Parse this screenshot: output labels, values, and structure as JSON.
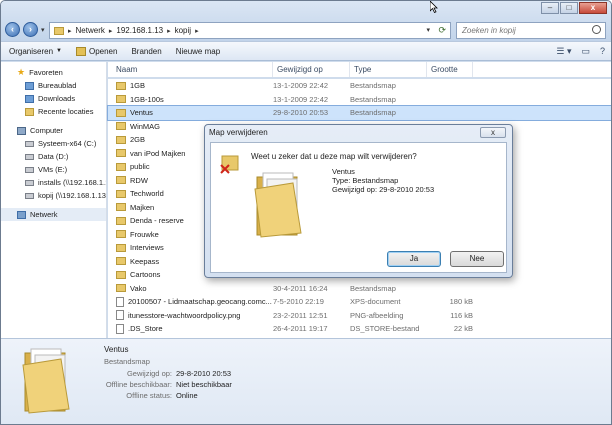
{
  "window": {
    "nav": {
      "back": "‹",
      "forward": "›"
    },
    "address": {
      "crumbs": [
        "Netwerk",
        "192.168.1.13",
        "kopij"
      ]
    },
    "search_placeholder": "Zoeken in kopij",
    "controls": {
      "minimize": "–",
      "maximize": "□",
      "close": "x"
    }
  },
  "toolbar": {
    "organize": "Organiseren",
    "open": "Openen",
    "burn": "Branden",
    "new_folder": "Nieuwe map"
  },
  "navpane": {
    "favorites": "Favoreten",
    "desktop": "Bureaublad",
    "downloads": "Downloads",
    "recent": "Recente locaties",
    "computer": "Computer",
    "drives": [
      "Systeem-x64 (C:)",
      "Data (D:)",
      "VMs (E:)",
      "installs (\\\\192.168.1.13",
      "kopij (\\\\192.168.1.13"
    ],
    "network": "Netwerk"
  },
  "columns": {
    "name": "Naam",
    "date": "Gewijzigd op",
    "type": "Type",
    "size": "Grootte"
  },
  "files": [
    {
      "name": "1GB",
      "date": "13-1-2009 22:42",
      "type": "Bestandsmap",
      "size": "",
      "icon": "folder"
    },
    {
      "name": "1GB-100s",
      "date": "13-1-2009 22:42",
      "type": "Bestandsmap",
      "size": "",
      "icon": "folder"
    },
    {
      "name": "Ventus",
      "date": "29-8-2010 20:53",
      "type": "Bestandsmap",
      "size": "",
      "icon": "folder"
    },
    {
      "name": "WinMAG",
      "date": "",
      "type": "",
      "size": "",
      "icon": "folder"
    },
    {
      "name": "2GB",
      "date": "",
      "type": "",
      "size": "",
      "icon": "folder"
    },
    {
      "name": "van iPod Majken",
      "date": "",
      "type": "",
      "size": "",
      "icon": "folder"
    },
    {
      "name": "public",
      "date": "",
      "type": "",
      "size": "",
      "icon": "folder"
    },
    {
      "name": "RDW",
      "date": "",
      "type": "",
      "size": "",
      "icon": "folder"
    },
    {
      "name": "Techworld",
      "date": "",
      "type": "",
      "size": "",
      "icon": "folder"
    },
    {
      "name": "Majken",
      "date": "",
      "type": "",
      "size": "",
      "icon": "folder"
    },
    {
      "name": "Denda - reserve",
      "date": "",
      "type": "",
      "size": "",
      "icon": "folder"
    },
    {
      "name": "Frouwke",
      "date": "",
      "type": "",
      "size": "",
      "icon": "folder"
    },
    {
      "name": "Interviews",
      "date": "",
      "type": "",
      "size": "",
      "icon": "folder"
    },
    {
      "name": "Keepass",
      "date": "",
      "type": "",
      "size": "",
      "icon": "folder"
    },
    {
      "name": "Cartoons",
      "date": "",
      "type": "",
      "size": "",
      "icon": "folder"
    },
    {
      "name": "Vako",
      "date": "30-4-2011 16:24",
      "type": "Bestandsmap",
      "size": "",
      "icon": "folder"
    },
    {
      "name": "20100507 - Lidmaatschap.geocang.comc...",
      "date": "7-5-2010 22:19",
      "type": "XPS-document",
      "size": "180 kB",
      "icon": "doc"
    },
    {
      "name": "itunesstore-wachtwoordpolicy.png",
      "date": "23-2-2011 12:51",
      "type": "PNG-afbeelding",
      "size": "116 kB",
      "icon": "doc"
    },
    {
      "name": ".DS_Store",
      "date": "26-4-2011 19:17",
      "type": "DS_STORE-bestand",
      "size": "22 kB",
      "icon": "doc"
    }
  ],
  "details": {
    "name": "Ventus",
    "type": "Bestandsmap",
    "rows": [
      {
        "label": "Gewijzigd op:",
        "value": "29-8-2010 20:53"
      },
      {
        "label": "Offline beschikbaar:",
        "value": "Niet beschikbaar"
      },
      {
        "label": "Offline status:",
        "value": "Online"
      }
    ]
  },
  "dialog": {
    "title": "Map verwijderen",
    "close": "x",
    "question": "Weet u zeker dat u deze map wilt verwijderen?",
    "folder_name": "Ventus",
    "folder_type": "Type: Bestandsmap",
    "folder_date": "Gewijzigd op: 29-8-2010 20:53",
    "yes": "Ja",
    "no": "Nee"
  },
  "colors": {
    "selection": "#cde3fb",
    "chrome": "#cfdcec",
    "folder": "#e8c86a"
  }
}
